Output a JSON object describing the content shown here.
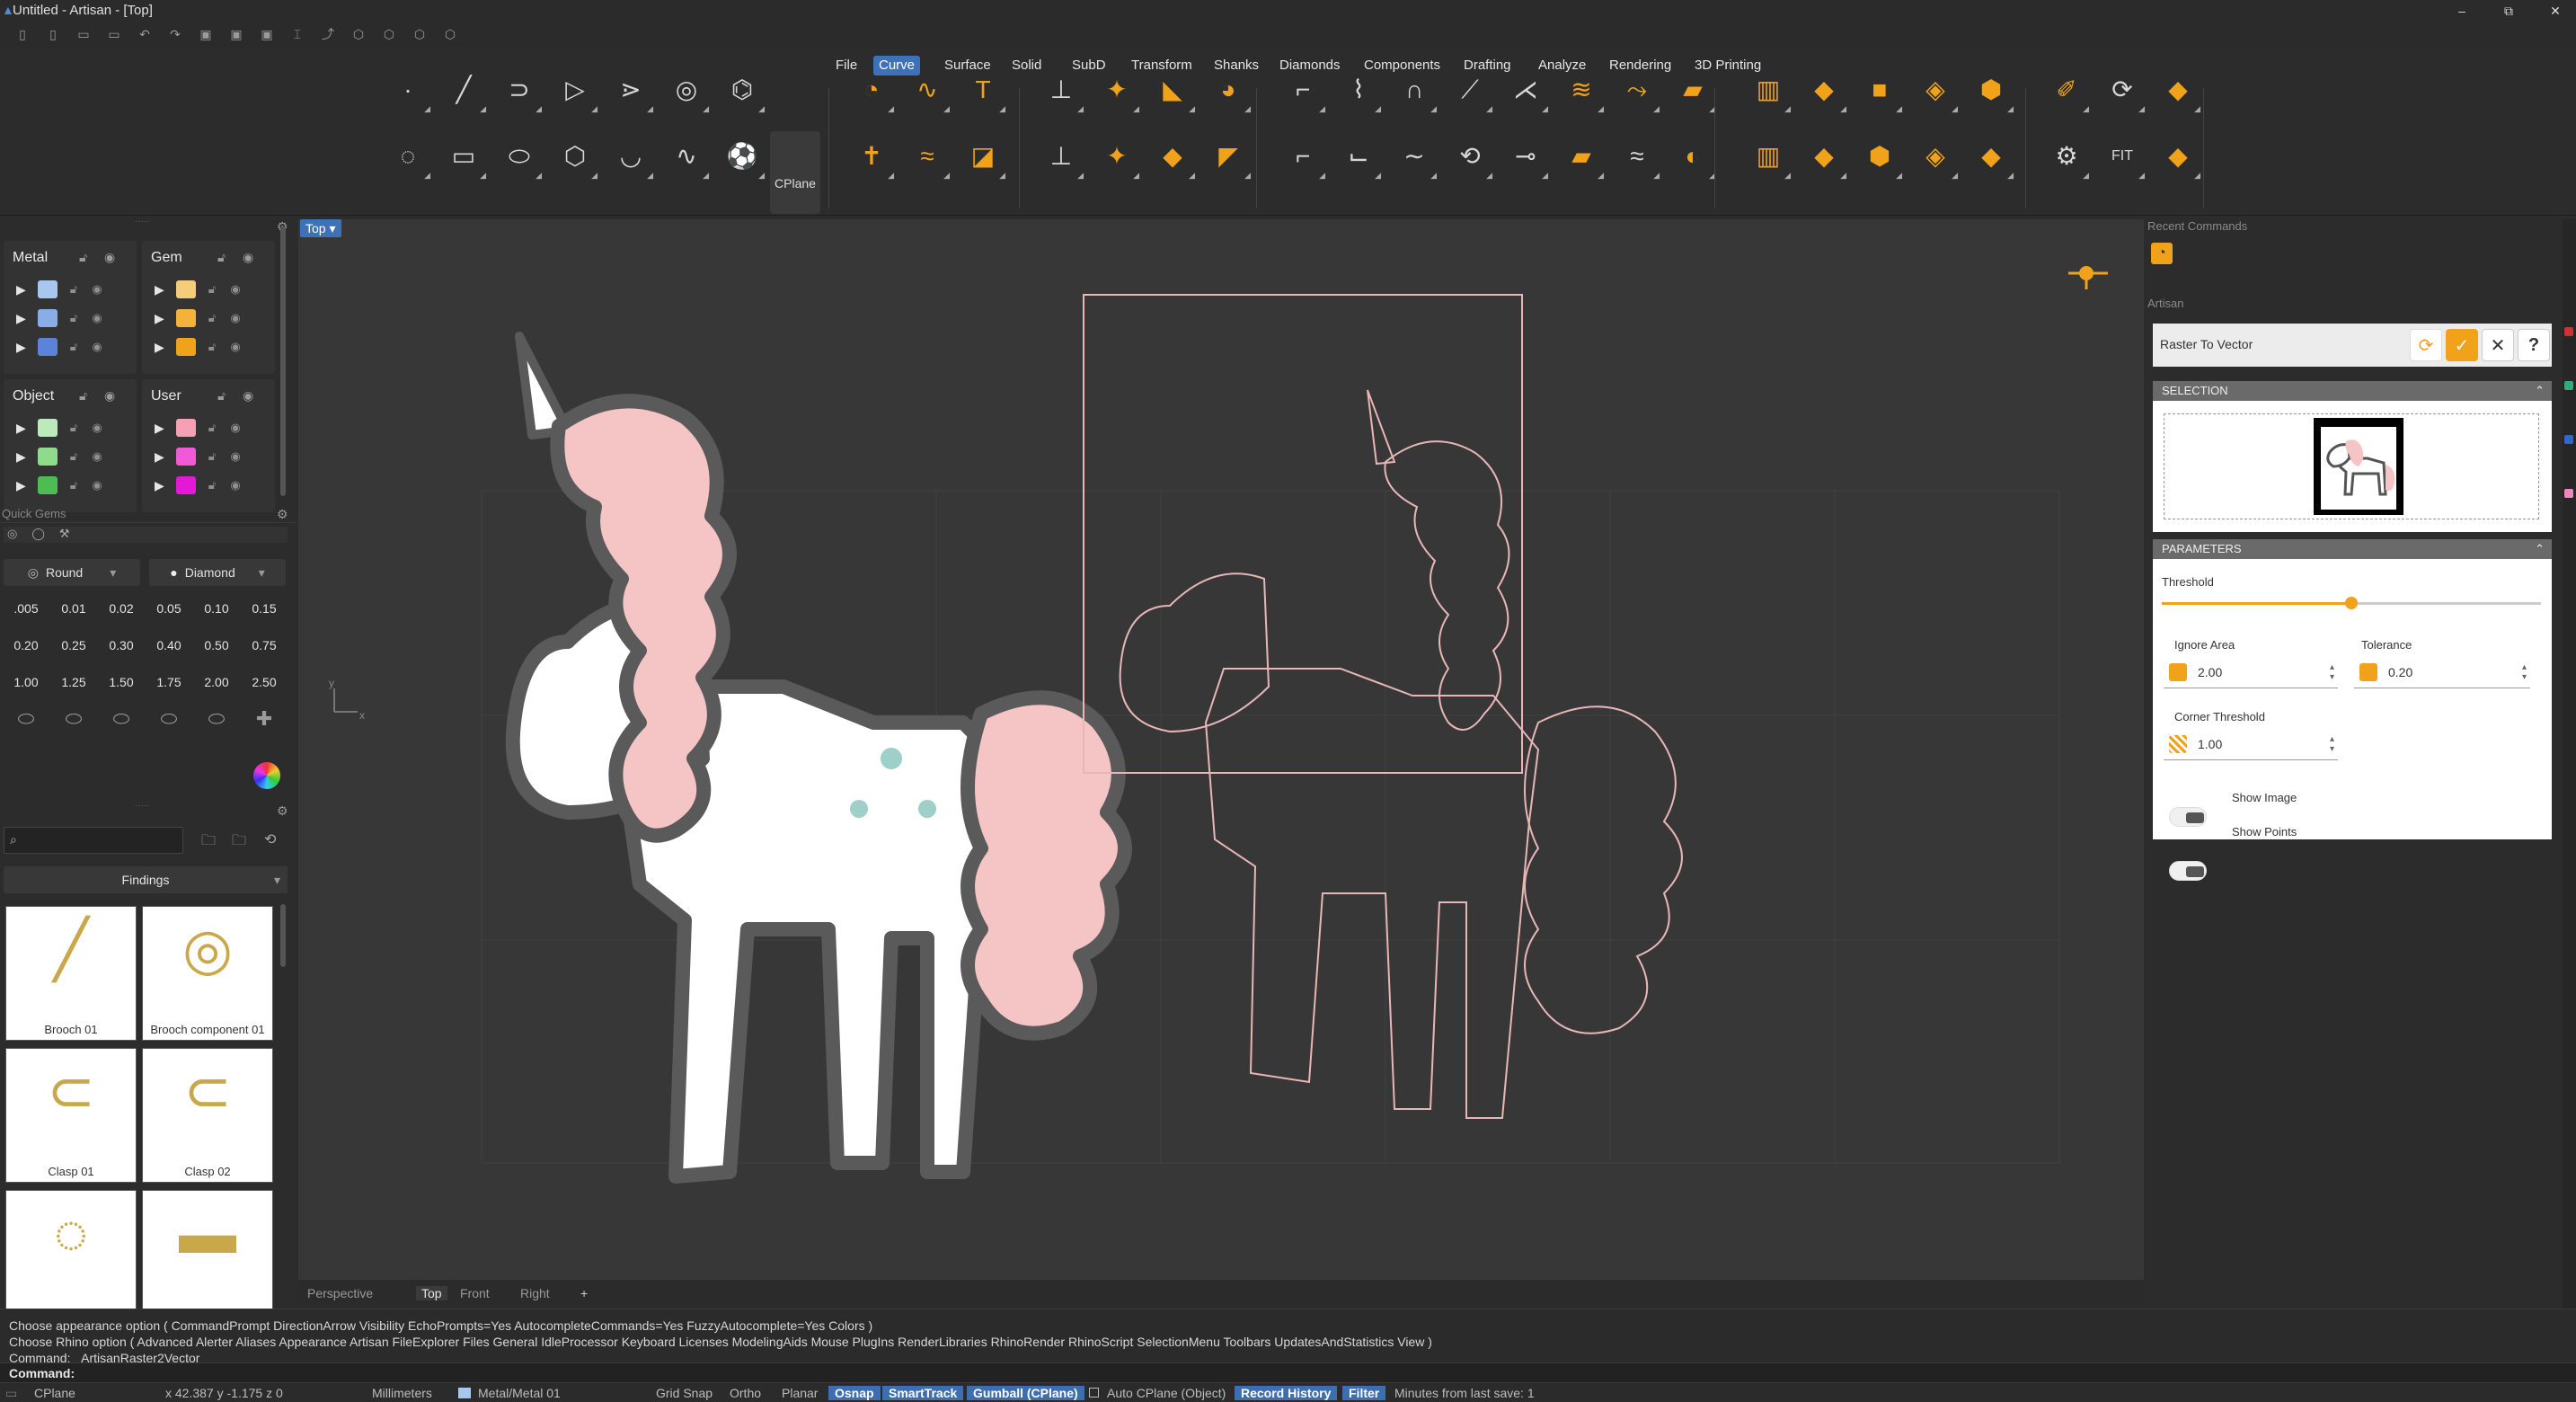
{
  "title_bar": {
    "title": "Untitled - Artisan - [Top]",
    "min": "–",
    "max": "⧉",
    "close": "✕"
  },
  "quick_access": [
    "▯",
    "▯",
    "▭",
    "▭",
    "↶",
    "↷",
    "▣",
    "▣",
    "▣",
    "⌶",
    "⤴",
    "⬡",
    "⬡",
    "⬡",
    "⬡"
  ],
  "menus": [
    "File",
    "Curve",
    "Surface",
    "Solid",
    "SubD",
    "Transform",
    "Shanks",
    "Diamonds",
    "Components",
    "Drafting",
    "Analyze",
    "Rendering",
    "3D Printing"
  ],
  "active_menu": "Curve",
  "toolbar": {
    "group1_top": [
      {
        "n": "point-icon",
        "g": "·"
      },
      {
        "n": "line-icon",
        "g": "╱"
      },
      {
        "n": "polyline-curve-icon",
        "g": "⊃"
      },
      {
        "n": "control-point-curve-icon",
        "g": "▷"
      },
      {
        "n": "interpolate-curve-icon",
        "g": "⋗"
      },
      {
        "n": "helix-icon",
        "g": "◎"
      },
      {
        "n": "spiral-icon",
        "g": "⌬"
      }
    ],
    "group1_bottom": [
      {
        "n": "circle-icon",
        "g": "◌"
      },
      {
        "n": "rectangle-icon",
        "g": "▭"
      },
      {
        "n": "ellipse-icon",
        "g": "⬭"
      },
      {
        "n": "polygon-icon",
        "g": "⬡"
      },
      {
        "n": "arc-icon",
        "g": "◡"
      },
      {
        "n": "blend-curve-icon",
        "g": "∿"
      },
      {
        "n": "soccer-ball-icon",
        "g": "⚽"
      }
    ],
    "cplane_label": "CPlane",
    "group2_top": [
      {
        "n": "raster-to-vector-icon",
        "g": "◔",
        "c": "o"
      },
      {
        "n": "freehand-curve-icon",
        "g": "∿",
        "c": "o"
      },
      {
        "n": "text-icon",
        "g": "T",
        "c": "o"
      }
    ],
    "group2_bottom": [
      {
        "n": "crosshair-curve-icon",
        "g": "✝",
        "c": "o"
      },
      {
        "n": "sweep-curve-icon",
        "g": "≈",
        "c": "o"
      },
      {
        "n": "image-trace-icon",
        "g": "◪",
        "c": "o"
      }
    ],
    "group3_top": [
      {
        "n": "split-curve-icon",
        "g": "⊥",
        "c": "w"
      },
      {
        "n": "gem-cluster-icon",
        "g": "✦",
        "c": "o"
      },
      {
        "n": "ring-cut-icon",
        "g": "◣",
        "c": "o"
      },
      {
        "n": "blob-icon",
        "g": "◕",
        "c": "o"
      }
    ],
    "group3_bottom": [
      {
        "n": "trim-curve-icon",
        "g": "⊥",
        "c": "w"
      },
      {
        "n": "gem-set-icon",
        "g": "✦",
        "c": "o"
      },
      {
        "n": "plate-icon",
        "g": "◆",
        "c": "o"
      },
      {
        "n": "tag-icon",
        "g": "◤",
        "c": "o"
      }
    ],
    "group4_top": [
      {
        "n": "fillet-curve-icon",
        "g": "⌐",
        "c": "w"
      },
      {
        "n": "offset-curve-icon",
        "g": "⌇",
        "c": "w"
      },
      {
        "n": "arch-icon",
        "g": "∩",
        "c": "w"
      },
      {
        "n": "extend-curve-icon",
        "g": "⟋",
        "c": "w"
      },
      {
        "n": "divide-curve-icon",
        "g": "⋌",
        "c": "w"
      },
      {
        "n": "wave-icon",
        "g": "≋",
        "c": "o"
      },
      {
        "n": "curve-along-icon",
        "g": "⤳",
        "c": "o"
      },
      {
        "n": "lay-flat-icon",
        "g": "▰",
        "c": "o"
      }
    ],
    "group4_bottom": [
      {
        "n": "chamfer-curve-icon",
        "g": "⌐",
        "c": "w"
      },
      {
        "n": "corner-icon",
        "g": "⌙",
        "c": "w"
      },
      {
        "n": "smooth-curve-icon",
        "g": "∼",
        "c": "w"
      },
      {
        "n": "rebuild-curve-icon",
        "g": "⟲",
        "c": "w"
      },
      {
        "n": "join-curve-icon",
        "g": "⊸",
        "c": "w"
      },
      {
        "n": "flatten-icon",
        "g": "▰",
        "c": "o"
      },
      {
        "n": "pattern-curve-icon",
        "g": "≈",
        "c": "w"
      },
      {
        "n": "curve-from-object-icon",
        "g": "◐",
        "c": "o"
      }
    ],
    "group5_top": [
      {
        "n": "cylinder-icon",
        "g": "▥",
        "c": "o"
      },
      {
        "n": "sheet-icon",
        "g": "◆",
        "c": "o"
      },
      {
        "n": "box-icon",
        "g": "■",
        "c": "o"
      },
      {
        "n": "bevel-box-icon",
        "g": "◈",
        "c": "o"
      },
      {
        "n": "octagon-icon",
        "g": "⬢",
        "c": "o"
      }
    ],
    "group5_bottom": [
      {
        "n": "cylinder-b-icon",
        "g": "▥",
        "c": "o"
      },
      {
        "n": "sheet-b-icon",
        "g": "◆",
        "c": "o"
      },
      {
        "n": "cushion-icon",
        "g": "⬢",
        "c": "o"
      },
      {
        "n": "bevel-sheet-icon",
        "g": "◈",
        "c": "o"
      },
      {
        "n": "flat-sheet-icon",
        "g": "◆",
        "c": "o"
      }
    ],
    "group6_top": [
      {
        "n": "paint-icon",
        "g": "✐",
        "c": "o"
      },
      {
        "n": "loop-icon",
        "g": "⟳",
        "c": "w"
      },
      {
        "n": "edit-sheet-icon",
        "g": "◆",
        "c": "o"
      }
    ],
    "group6_bottom": [
      {
        "n": "settings-gear-icon",
        "g": "⚙",
        "c": "w"
      },
      {
        "n": "fit-view-icon",
        "g": "FIT",
        "c": "w"
      },
      {
        "n": "edit-sheet-b-icon",
        "g": "◆",
        "c": "o"
      }
    ]
  },
  "layers": {
    "metal_label": "Metal",
    "gem_label": "Gem",
    "object_label": "Object",
    "user_label": "User",
    "metal": [
      "#a7c6f0",
      "#89aee6",
      "#5b84d8"
    ],
    "gem": [
      "#f5cc7a",
      "#f2b23c",
      "#f0a21b"
    ],
    "object": [
      "#bdeabb",
      "#8edc8b",
      "#4dbd53"
    ],
    "user": [
      "#f5a0b5",
      "#f05ad6",
      "#e419d8"
    ]
  },
  "quick_gems": {
    "header": "Quick Gems",
    "shape": "Round",
    "material": "Diamond",
    "sizes": [
      ".005",
      "0.01",
      "0.02",
      "0.05",
      "0.10",
      "0.15",
      "0.20",
      "0.25",
      "0.30",
      "0.40",
      "0.50",
      "0.75",
      "1.00",
      "1.25",
      "1.50",
      "1.75",
      "2.00",
      "2.50"
    ],
    "shapes": [
      "⬭",
      "⬭",
      "⬭",
      "⬭",
      "⬭",
      "✚"
    ]
  },
  "library": {
    "search_placeholder": "",
    "category": "Findings",
    "items": [
      {
        "label": "Brooch 01"
      },
      {
        "label": "Brooch component 01"
      },
      {
        "label": "Clasp 01"
      },
      {
        "label": "Clasp 02"
      },
      {
        "label": ""
      },
      {
        "label": ""
      }
    ]
  },
  "viewport": {
    "name": "Top",
    "tabs": [
      "Perspective",
      "Top",
      "Front",
      "Right"
    ],
    "add": "+",
    "active_tab": "Top",
    "axis_x": "x",
    "axis_y": "y"
  },
  "right_panel": {
    "recent_header": "Recent Commands",
    "artisan_header": "Artisan",
    "command": "Raster To Vector",
    "selection_header": "SELECTION",
    "parameters_header": "PARAMETERS",
    "threshold_label": "Threshold",
    "threshold_value": 0.5,
    "ignore_area_label": "Ignore Area",
    "ignore_area_value": "2.00",
    "tolerance_label": "Tolerance",
    "tolerance_value": "0.20",
    "corner_label": "Corner Threshold",
    "corner_value": "1.00",
    "show_image": "Show Image",
    "show_points": "Show Points",
    "help": "?"
  },
  "command_history": [
    "Choose appearance option ( CommandPrompt  DirectionArrow  Visibility  EchoPrompts=Yes  AutocompleteCommands=Yes  FuzzyAutocomplete=Yes  Colors )",
    "Choose Rhino option ( Advanced  Alerter  Aliases  Appearance  Artisan  FileExplorer  Files  General  IdleProcessor  Keyboard  Licenses  ModelingAids  Mouse  PlugIns  RenderLibraries  RhinoRender  RhinoScript  SelectionMenu  Toolbars  UpdatesAndStatistics  View )",
    "Command: _ArtisanRaster2Vector"
  ],
  "command_prompt": "Command:",
  "status": {
    "cplane": "CPlane",
    "coords": "x 42.387   y -1.175   z 0",
    "units": "Millimeters",
    "layer": "Metal/Metal 01",
    "grid_snap": "Grid Snap",
    "ortho": "Ortho",
    "planar": "Planar",
    "osnap": "Osnap",
    "smarttrack": "SmartTrack",
    "gumball": "Gumball (CPlane)",
    "autocplane": "Auto CPlane (Object)",
    "record": "Record History",
    "filter": "Filter",
    "minutes": "Minutes from last save: 1"
  }
}
